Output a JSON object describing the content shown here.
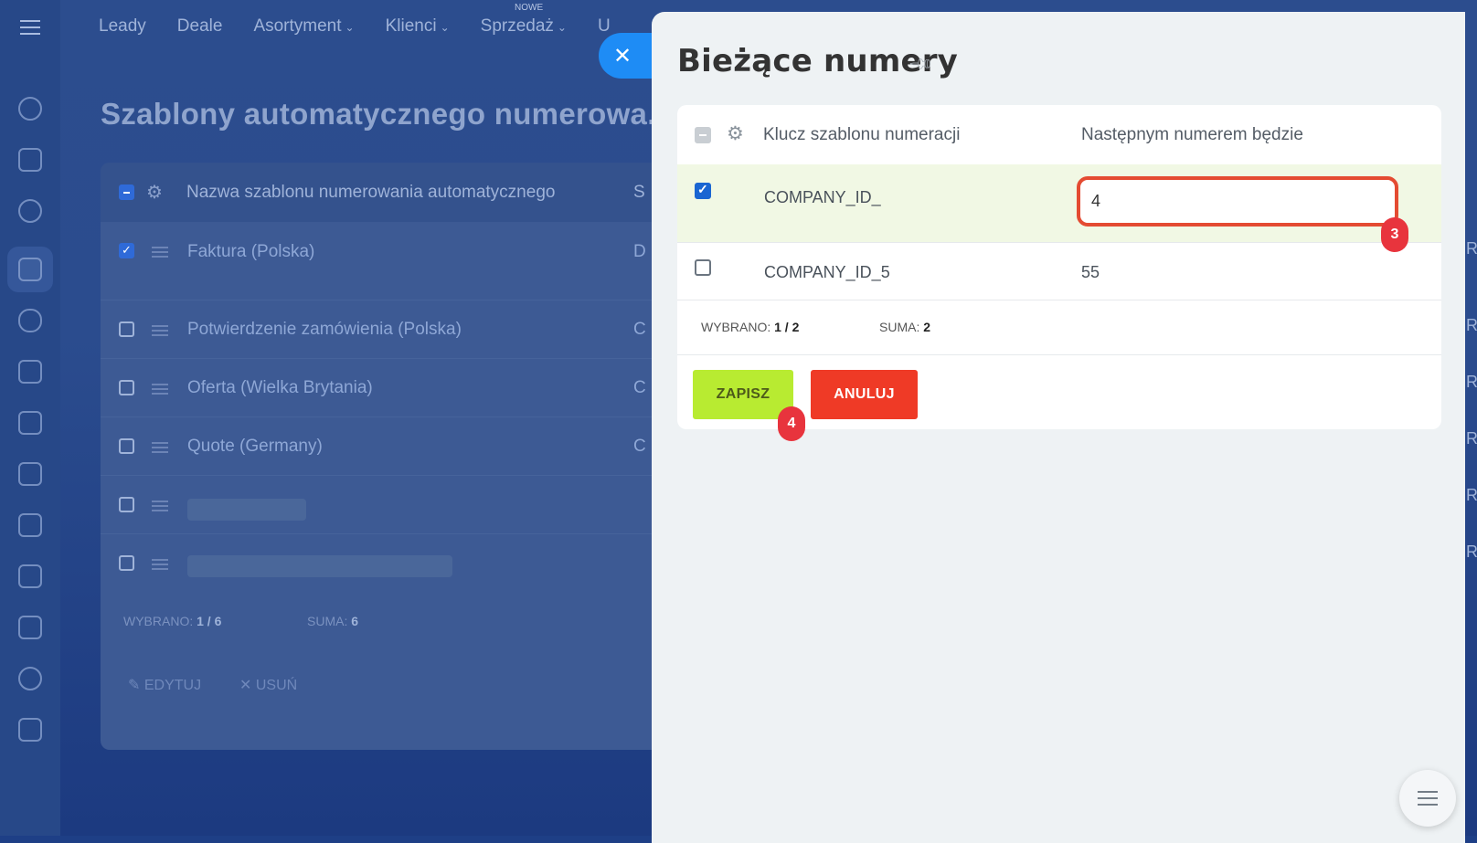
{
  "topnav": {
    "items": [
      "Leady",
      "Deale",
      "Asortyment",
      "Klienci",
      "Sprzedaż"
    ],
    "badge": "NOWE",
    "clipped_item": "U"
  },
  "background_page": {
    "title": "Szablony automatycznego numerowa...",
    "header_column": "Nazwa szablonu numerowania automatycznego",
    "header_column_clipped": "S",
    "rows": [
      {
        "name": "Faktura (Polska)",
        "checked": true,
        "side": "D"
      },
      {
        "name": "Potwierdzenie zamówienia (Polska)",
        "checked": false,
        "side": "C"
      },
      {
        "name": "Oferta (Wielka Brytania)",
        "checked": false,
        "side": "C"
      },
      {
        "name": "Quote (Germany)",
        "checked": false,
        "side": "C"
      }
    ],
    "footer": {
      "selected_label": "WYBRANO:",
      "selected_value": "1 / 6",
      "total_label": "SUMA:",
      "total_value": "6"
    },
    "actions": {
      "edit": "EDYTUJ",
      "delete": "USUŃ"
    }
  },
  "panel": {
    "title": "Bieżące numery",
    "columns": {
      "key": "Klucz szablonu numeracji",
      "next": "Następnym numerem będzie"
    },
    "rows": [
      {
        "key": "COMPANY_ID_",
        "next": "4",
        "checked": true,
        "editing": true
      },
      {
        "key": "COMPANY_ID_5",
        "next": "55",
        "checked": false,
        "editing": false
      }
    ],
    "footer": {
      "selected_label": "WYBRANO:",
      "selected_value": "1 / 2",
      "total_label": "SUMA:",
      "total_value": "2"
    },
    "buttons": {
      "save": "ZAPISZ",
      "cancel": "ANULUJ"
    },
    "markers": {
      "input_marker": "3",
      "save_marker": "4"
    }
  },
  "colors": {
    "save": "#b8eb31",
    "cancel": "#ef3a26",
    "highlight": "#e44b32",
    "selected_row": "#f1f8e4"
  }
}
